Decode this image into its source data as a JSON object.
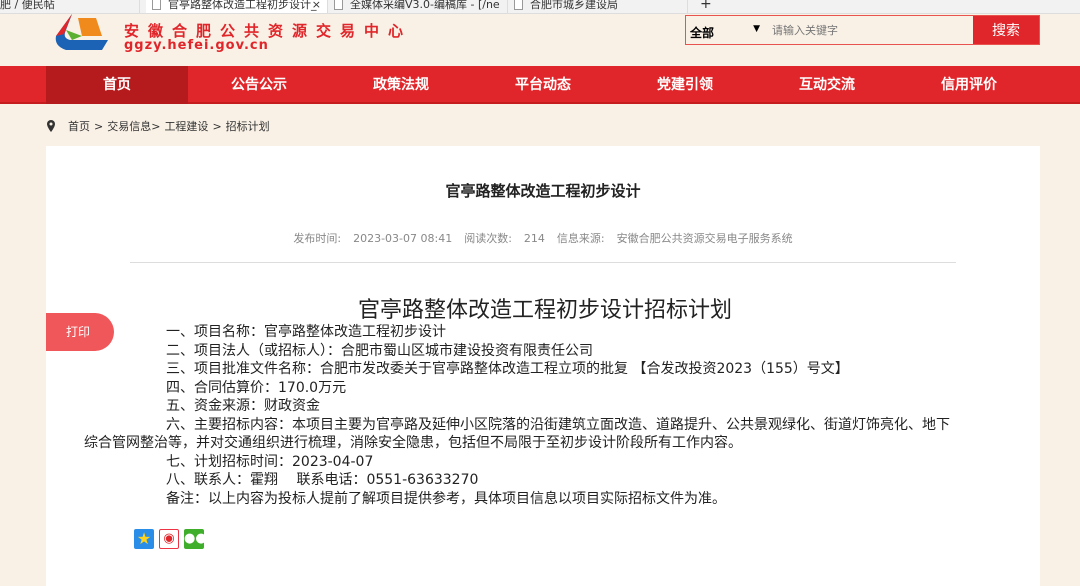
{
  "browser": {
    "tabs": [
      {
        "title": "肥 / 便民帖"
      },
      {
        "title": "官亭路整体改造工程初步设计_"
      },
      {
        "title": "全媒体采编V3.0-编稿库 - [/ne"
      },
      {
        "title": "合肥市城乡建设局"
      }
    ],
    "close": "×",
    "new_tab": "+"
  },
  "header": {
    "site_name": "安徽合肥公共资源交易中心",
    "site_url": "ggzy.hefei.gov.cn",
    "search": {
      "scope": "全部",
      "placeholder": "请输入关键字",
      "button": "搜索"
    }
  },
  "nav": {
    "items": [
      {
        "label": "首页"
      },
      {
        "label": "公告公示"
      },
      {
        "label": "政策法规"
      },
      {
        "label": "平台动态"
      },
      {
        "label": "党建引领"
      },
      {
        "label": "互动交流"
      },
      {
        "label": "信用评价"
      }
    ]
  },
  "breadcrumb": {
    "items": [
      "首页",
      ">",
      "交易信息>",
      "工程建设",
      ">",
      "招标计划"
    ]
  },
  "article": {
    "title": "官亭路整体改造工程初步设计",
    "meta": {
      "publish_label": "发布时间:",
      "publish_time": "2023-03-07 08:41",
      "reads_label": "阅读次数:",
      "reads": "214",
      "source_label": "信息来源:",
      "source": "安徽合肥公共资源交易电子服务系统"
    },
    "print": "打印",
    "heading": "官亭路整体改造工程初步设计招标计划",
    "paragraphs": [
      "一、项目名称：官亭路整体改造工程初步设计",
      "二、项目法人（或招标人）：合肥市蜀山区城市建设投资有限责任公司",
      "三、项目批准文件名称：合肥市发改委关于官亭路整体改造工程立项的批复 【合发改投资2023（155）号文】",
      "四、合同估算价：170.0万元",
      "五、资金来源：财政资金",
      "六、主要招标内容：本项目主要为官亭路及延伸小区院落的沿街建筑立面改造、道路提升、公共景观绿化、街道灯饰亮化、地下综合管网整治等，并对交通组织进行梳理，消除安全隐患，包括但不局限于至初步设计阶段所有工作内容。",
      "七、计划招标时间：2023-04-07",
      "八、联系人：霍翔　 联系电话：0551-63633270",
      "备注：以上内容为投标人提前了解项目提供参考，具体项目信息以项目实际招标文件为准。"
    ]
  },
  "share": {
    "icons": [
      "qzone-icon",
      "weibo-icon",
      "wechat-icon"
    ]
  }
}
